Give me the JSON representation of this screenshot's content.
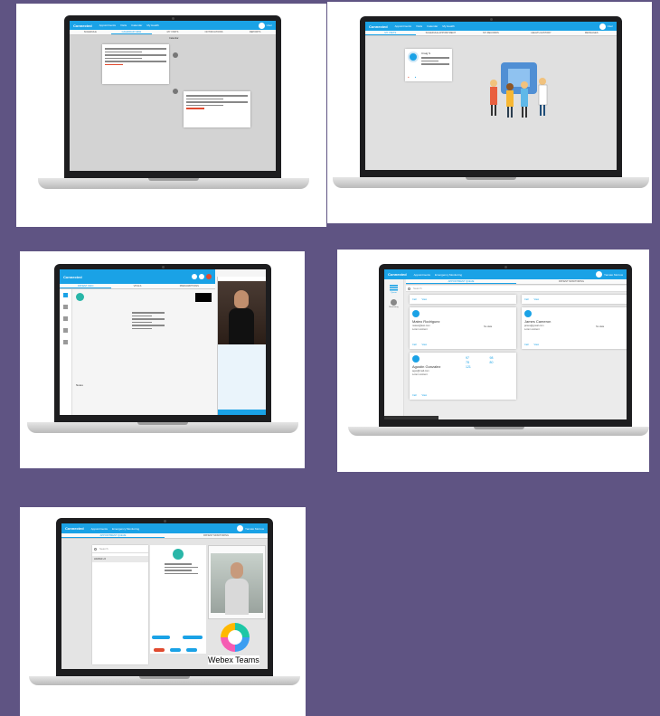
{
  "screens": {
    "a": {
      "brand": "Connected",
      "nav": [
        "Appointments",
        "Visits",
        "Calendar",
        "My Health"
      ],
      "user": "User",
      "tabs": [
        "SCHEDULE",
        "CALENDAR VIEW",
        "MY VISITS",
        "NOTIFICATIONS",
        "REPORTS"
      ],
      "filter": "Calendar"
    },
    "b": {
      "brand": "Connected",
      "nav": [
        "Appointments",
        "Visits",
        "Calendar",
        "My Health"
      ],
      "user": "User",
      "tabs": [
        "MY VISITS",
        "SCHEDULE APPOINTMENT",
        "MY RECORDS",
        "HEALTH HISTORY",
        "MESSAGES"
      ],
      "patient_name": "Craig S"
    },
    "c": {
      "brand": "Connected",
      "tabs": [
        "PATIENT INFO",
        "VITALS",
        "PRESCRIPTIONS"
      ],
      "notes_label": "Notes"
    },
    "d": {
      "brand": "Connected",
      "nav": [
        "Appointments",
        "Emergency Monitoring"
      ],
      "user_name": "Yamato Morrow",
      "user_role": "Admin",
      "tabs": [
        "APPOINTMENT QUEUE",
        "PATIENT MONITORING"
      ],
      "search_placeholder": "Search",
      "sidebar_label": "Queue",
      "device_label": "Monitoring",
      "call_label": "Call",
      "view_label": "View",
      "no_data": "No data",
      "patients": [
        {
          "name": "Mateo Rodriguez",
          "email": "mateo@test.com",
          "line": "Lorem content"
        },
        {
          "name": "James Cameron",
          "email": "james@gmail.com",
          "line": "Lorem content"
        },
        {
          "name": "Agustin Gonzalez",
          "email": "agus@mail.com",
          "line": "Lorem content"
        }
      ],
      "vitals": [
        {
          "v": "97"
        },
        {
          "v": "98"
        },
        {
          "v": "78"
        },
        {
          "v": "80"
        },
        {
          "v": "121"
        }
      ]
    },
    "e": {
      "brand": "Connected",
      "nav": [
        "Appointments",
        "Emergency Monitoring"
      ],
      "user": "Yamato Morrow",
      "tabs": [
        "APPOINTMENT QUEUE",
        "PATIENT MONITORING"
      ],
      "search_placeholder": "Search",
      "queue_item": "HANNA LO",
      "webex_label": "Webex Teams"
    }
  },
  "colors": {
    "background": "#5f5483",
    "accent": "#1aa2e6",
    "alert": "#e04a2f"
  }
}
